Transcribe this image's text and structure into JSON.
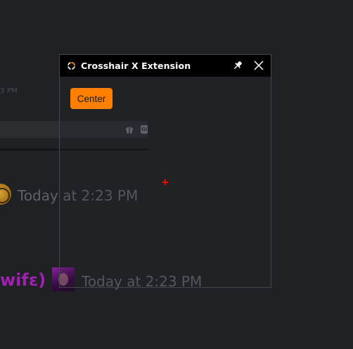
{
  "background": {
    "small_timestamp": "3 PM",
    "messages": [
      {
        "timestamp": "Today at 2:23 PM"
      },
      {
        "username": "wifɛ)",
        "timestamp": "Today at 2:23 PM"
      }
    ],
    "composer": {
      "gift_icon": "gift-icon",
      "gif_label": "GIF"
    }
  },
  "extension": {
    "title": "Crosshair X Extension",
    "center_button_label": "Center",
    "pin_icon": "pin-icon",
    "close_icon": "close-icon",
    "accent_color": "#ff7f00",
    "crosshair_color": "#ff0000"
  }
}
